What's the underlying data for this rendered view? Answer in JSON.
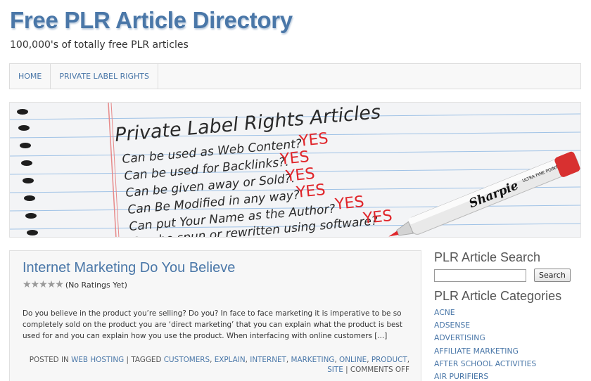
{
  "site": {
    "title": "Free PLR Article Directory",
    "tagline": "100,000's of totally free PLR articles"
  },
  "nav": {
    "items": [
      {
        "label": "HOME"
      },
      {
        "label": "PRIVATE LABEL RIGHTS"
      }
    ]
  },
  "banner": {
    "heading": "Private Label Rights Articles",
    "lines": [
      {
        "question": "Can be used as Web Content?",
        "answer": "YES"
      },
      {
        "question": "Can be used for Backlinks?.",
        "answer": "YES"
      },
      {
        "question": "Can be given away or Sold?.",
        "answer": "YES"
      },
      {
        "question": "Can Be Modified in any way?",
        "answer": "YES"
      },
      {
        "question": "Can put Your Name as the Author?",
        "answer": "YES"
      },
      {
        "question": "Can be spun or rewritten using software?",
        "answer": "YES"
      }
    ],
    "pen_brand": "Sharpie",
    "pen_label": "ULTRA FINE POINT",
    "colors": {
      "answer": "#e0252a",
      "line": "#9fc2e6",
      "margin": "#e78a8a"
    }
  },
  "post": {
    "title": "Internet Marketing Do You Believe",
    "rating": {
      "stars": 5,
      "filled": 0,
      "text": "(No Ratings Yet)"
    },
    "excerpt": "Do you believe in the product you’re selling? Do you? In face to face marketing it is imperative to be so completely sold on the product you are ‘direct marketing’ that you can explain what the product is best used for and you can explain how you use the product. When interfacing with online customers [...]",
    "meta": {
      "posted_in_label": "POSTED IN",
      "category": "WEB HOSTING",
      "tagged_label": "TAGGED",
      "tags": [
        "CUSTOMERS",
        "EXPLAIN",
        "INTERNET",
        "MARKETING",
        "ONLINE",
        "PRODUCT",
        "SITE"
      ],
      "comments": "COMMENTS OFF"
    }
  },
  "sidebar": {
    "search_title": "PLR Article Search",
    "search_value": "",
    "search_button": "Search",
    "categories_title": "PLR Article Categories",
    "categories": [
      "ACNE",
      "ADSENSE",
      "ADVERTISING",
      "AFFILIATE MARKETING",
      "AFTER SCHOOL ACTIVITIES",
      "AIR PURIFIERS"
    ]
  },
  "colors": {
    "link": "#4a77a8",
    "title": "#4a77a8"
  }
}
